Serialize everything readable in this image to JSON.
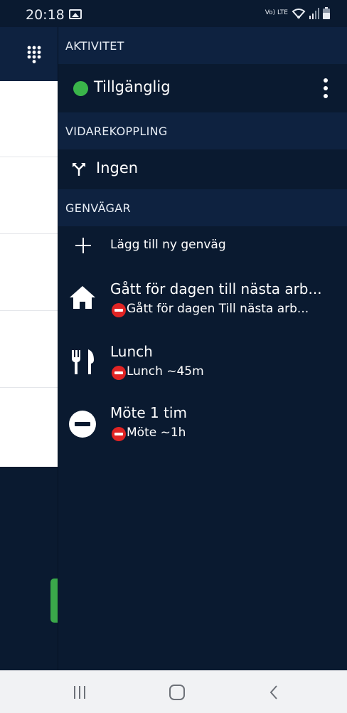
{
  "status_bar": {
    "time": "20:18",
    "network_label": "Vo) LTE",
    "icons": [
      "image-icon",
      "wifi-icon",
      "signal-icon",
      "battery-icon"
    ]
  },
  "left_panel": {
    "toolbar_icon": "dialpad-icon"
  },
  "drawer": {
    "activity": {
      "header": "AKTIVITET",
      "status_label": "Tillgänglig",
      "status_color": "#3ab54a",
      "menu_icon": "more-vertical-icon"
    },
    "forwarding": {
      "header": "VIDAREKOPPLING",
      "label": "Ingen",
      "icon": "call-forward-icon"
    },
    "shortcuts": {
      "header": "GENVÄGAR",
      "add_label": "Lägg till ny genväg",
      "items": [
        {
          "icon": "home-icon",
          "title": "Gått för dagen till nästa arb...",
          "subtitle": "Gått för dagen Till nästa arb..."
        },
        {
          "icon": "cutlery-icon",
          "title": "Lunch",
          "subtitle": "Lunch ~45m"
        },
        {
          "icon": "minus-circle-icon",
          "title": "Möte 1 tim",
          "subtitle": "Möte ~1h"
        }
      ]
    }
  },
  "colors": {
    "background": "#0a1a30",
    "header_background": "#0e2240",
    "busy_red": "#e02424",
    "nav_bar": "#f1f2f4"
  }
}
